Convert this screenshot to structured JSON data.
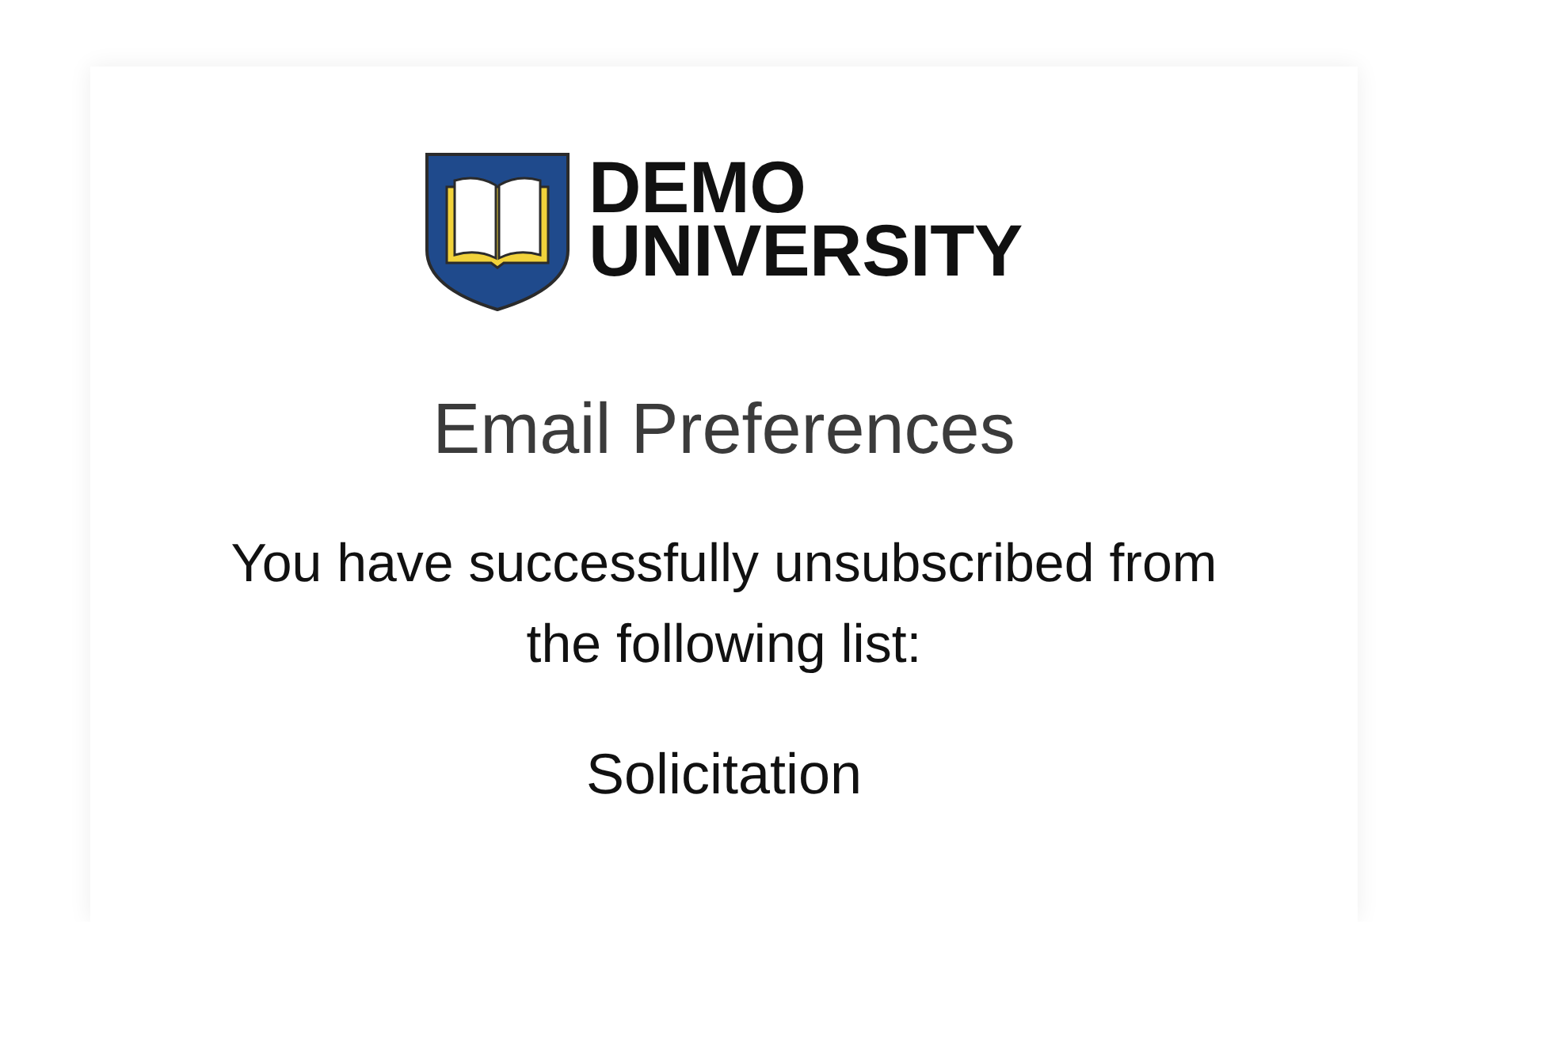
{
  "logo": {
    "line_1": "DEMO",
    "line_2": "UNIVERSITY"
  },
  "title": "Email Preferences",
  "message": "You have successfully unsubscribed from the following list:",
  "list_name": "Solicitation"
}
